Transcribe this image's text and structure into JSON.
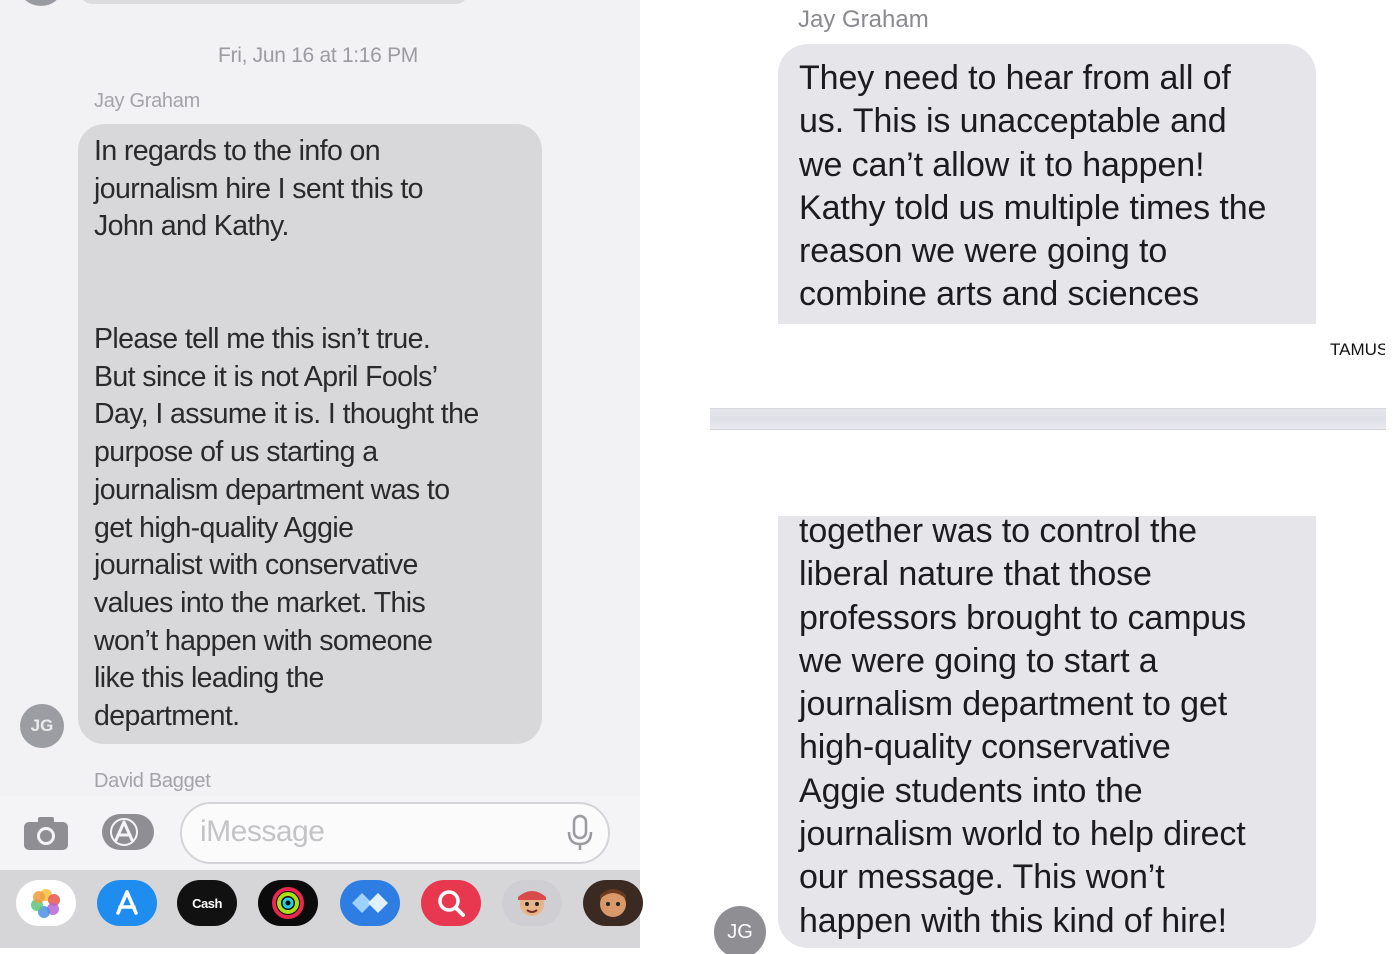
{
  "left_screenshot": {
    "timestamp": "Fri, Jun 16 at 1:16 PM",
    "sender_name": "Jay Graham",
    "message_paragraph_1": "In regards to the info on\njournalism hire I sent this to\nJohn and Kathy.",
    "message_paragraph_2": "Please tell me this isn’t true.\nBut since it is not April Fools’\nDay, I assume it is. I thought the\npurpose of us starting a\njournalism department was to\nget high-quality Aggie\njournalist with conservative\nvalues into the market. This\nwon’t happen with someone\nlike this leading the\ndepartment.",
    "avatar_initials": "JG",
    "next_sender_name": "David Bagget",
    "input_placeholder": "iMessage",
    "app_tray": [
      {
        "icon": "photos-icon"
      },
      {
        "icon": "app-store-icon"
      },
      {
        "icon": "cash-app-icon",
        "label": "Cash"
      },
      {
        "icon": "activity-icon"
      },
      {
        "icon": "shortcuts-icon"
      },
      {
        "icon": "search-images-icon"
      },
      {
        "icon": "memoji-icon"
      },
      {
        "icon": "animoji-icon"
      }
    ]
  },
  "right_screenshot": {
    "sender_name": "Jay Graham",
    "message_part_1": "They need to hear from all of\nus. This is unacceptable and\nwe can’t allow it to happen!\nKathy told us multiple times the\nreason we were going to\ncombine arts and sciences",
    "watermark": "TAMUS",
    "message_part_2": "together was to control the\nliberal nature that those\nprofessors brought to campus\nwe were going to start a\njournalism department to get\nhigh-quality conservative\nAggie students into the\njournalism world to help direct\nour message. This won’t\nhappen with this kind of hire!",
    "avatar_initials": "JG"
  },
  "colors": {
    "left_bubble": "#d8d8da",
    "right_bubble": "#e5e5ea",
    "avatar_gray": "#8e8e93",
    "ios_blue": "#1f8cf0"
  }
}
